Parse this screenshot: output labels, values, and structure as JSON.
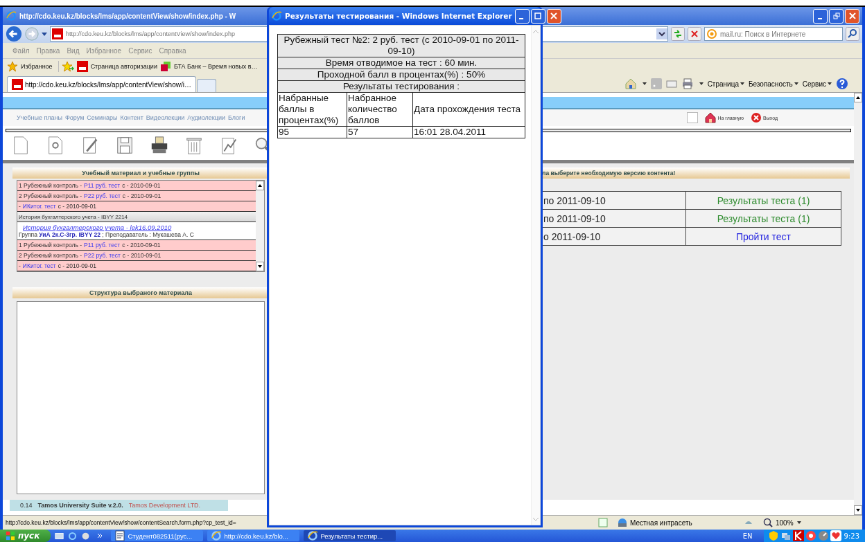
{
  "browser": {
    "title": "http://cdo.keu.kz/blocks/lms/app/contentView/show/index.php - W",
    "address": "http://cdo.keu.kz/blocks/lms/app/contentView/show/index.php",
    "search": {
      "placeholder": "mail.ru: Поиск в Интернете"
    },
    "menu": [
      "Файл",
      "Правка",
      "Вид",
      "Избранное",
      "Сервис",
      "Справка"
    ],
    "favorites": {
      "label": "Избранное",
      "links": [
        "Страница авторизации",
        "БТА Банк – Время новых в…"
      ]
    },
    "tabs": [
      {
        "label": "http://cdo.keu.kz/blocks/lms/app/contentView/show/i…",
        "selected": true
      }
    ],
    "command_bar": [
      "Страница",
      "Безопасность",
      "Сервис"
    ],
    "status_bar": {
      "url": "http://cdo.keu.kz/blocks/lms/app/contentView/show/contentSearch.form.php?cp_test_id=",
      "zone": "Местная интрасеть",
      "zoom": "100%"
    }
  },
  "site": {
    "nav": [
      "Учебные планы",
      "Форум",
      "Семинары",
      "Контент",
      "Видеолекции",
      "Аудиолекции",
      "Блоги"
    ],
    "home": "На главную",
    "exit": "Выход",
    "materials": {
      "title": "Учебный материал и учебные группы",
      "rows": [
        {
          "kind": "test",
          "prefix": "1 Рубежный контроль -",
          "link": "P11 руб. тест",
          "suffix": "с - 2010-09-01"
        },
        {
          "kind": "test",
          "prefix": "2 Рубежный контроль -",
          "link": "P22 руб. тест",
          "suffix": "с - 2010-09-01"
        },
        {
          "kind": "test",
          "prefix": "-",
          "link": "ИКитог. тест",
          "suffix": "с - 2010-09-01"
        },
        {
          "kind": "course",
          "text": "История бухгалтерского учета - IBYY 2214"
        },
        {
          "kind": "lecture",
          "link": "История бухгалтерского учета - lek16.09.2010",
          "info": "Группа **УиА 2к.С-3гр. IBYY 22** ; Преподаватель : Мукашева А. С"
        },
        {
          "kind": "test",
          "prefix": "1 Рубежный контроль -",
          "link": "P11 руб. тест",
          "suffix": "с - 2010-09-01"
        },
        {
          "kind": "test",
          "prefix": "2 Рубежный контроль -",
          "link": "P22 руб. тест",
          "suffix": "с - 2010-09-01"
        },
        {
          "kind": "test",
          "prefix": "-",
          "link": "ИКитог. тест",
          "suffix": "с - 2010-09-01"
        }
      ]
    },
    "structure": {
      "title": "Структура выбраного материала"
    },
    "notice": "ла выберите необходимую версию контента!",
    "tests": [
      {
        "period": "по 2011-09-10",
        "action": "Результаты теста (1)",
        "kind": "results"
      },
      {
        "period": "по 2011-09-10",
        "action": "Результаты теста (1)",
        "kind": "results"
      },
      {
        "period": "о 2011-09-10",
        "action": "Пройти тест",
        "kind": "take"
      }
    ],
    "footer": {
      "version": "0.14",
      "product": "Tamos University Suite v.2.0.",
      "company": "Tamos Development LTD."
    }
  },
  "popup": {
    "title": "Результаты тестирования - Windows Internet Explorer",
    "test_title": "Рубежный тест №2: 2 руб. тест (с 2010-09-01 по 2011-09-10)",
    "time": "Время отводимое на тест : 60 мин.",
    "pass_score": "Проходной балл в процентах(%) : 50%",
    "results_heading": "Результаты тестирования :",
    "columns": [
      "Набранные баллы в процентах(%)",
      "Набранное количество баллов",
      "Дата прохождения теста"
    ],
    "rows": [
      [
        "95",
        "57",
        "16:01 28.04.2011"
      ]
    ]
  },
  "taskbar": {
    "start": "пуск",
    "tasks": [
      {
        "label": "Студент082511(рус...",
        "kind": "doc",
        "selected": false
      },
      {
        "label": "http://cdo.keu.kz/blo...",
        "kind": "ie",
        "selected": false
      },
      {
        "label": "Результаты тестир...",
        "kind": "ie",
        "selected": true
      }
    ],
    "language": "EN",
    "clock": "9:23"
  }
}
